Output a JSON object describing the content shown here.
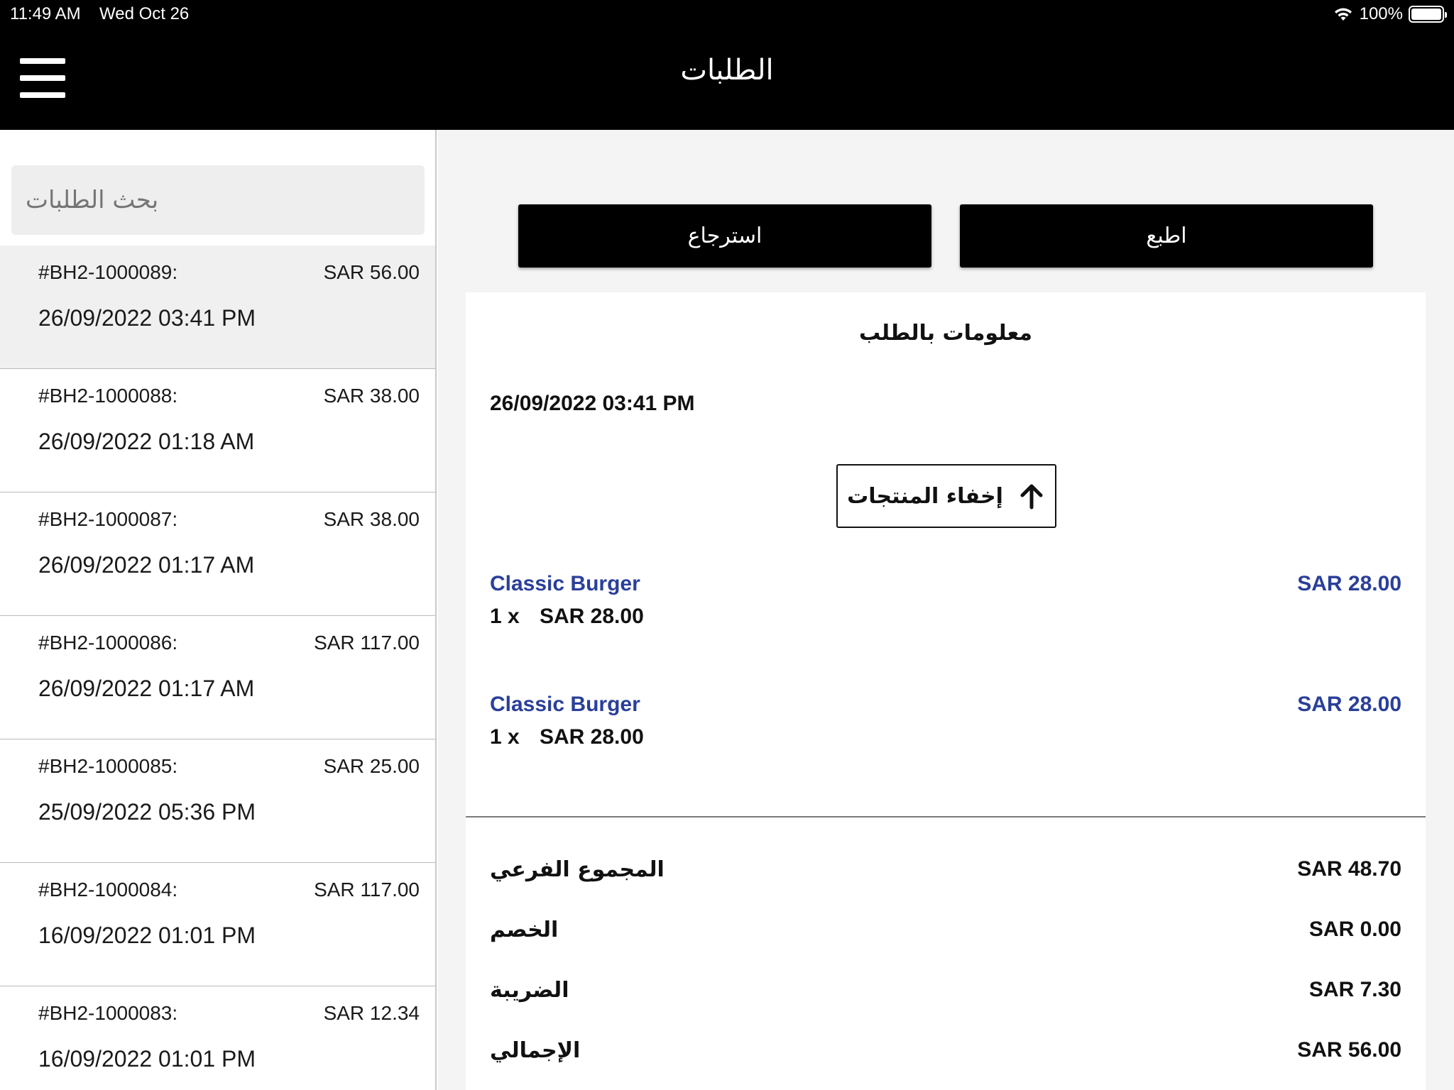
{
  "status_bar": {
    "time": "11:49 AM",
    "date": "Wed Oct 26",
    "battery": "100%",
    "wifi_icon": "wifi-icon",
    "battery_level": 1.0
  },
  "header": {
    "title": "الطلبات",
    "menu_icon": "hamburger-menu-icon"
  },
  "search": {
    "placeholder": "بحث الطلبات"
  },
  "orders": [
    {
      "id": "#BH2-1000089:",
      "price": "SAR 56.00",
      "date": "26/09/2022 03:41 PM",
      "selected": true
    },
    {
      "id": "#BH2-1000088:",
      "price": "SAR 38.00",
      "date": "26/09/2022 01:18 AM"
    },
    {
      "id": "#BH2-1000087:",
      "price": "SAR 38.00",
      "date": "26/09/2022 01:17 AM"
    },
    {
      "id": "#BH2-1000086:",
      "price": "SAR 117.00",
      "date": "26/09/2022 01:17 AM"
    },
    {
      "id": "#BH2-1000085:",
      "price": "SAR 25.00",
      "date": "25/09/2022 05:36 PM"
    },
    {
      "id": "#BH2-1000084:",
      "price": "SAR 117.00",
      "date": "16/09/2022 01:01 PM"
    },
    {
      "id": "#BH2-1000083:",
      "price": "SAR 12.34",
      "date": "16/09/2022 01:01 PM"
    }
  ],
  "actions": {
    "refund_label": "استرجاع",
    "print_label": "اطبع"
  },
  "detail": {
    "title": "معلومات بالطلب",
    "date": "26/09/2022 03:41 PM",
    "hide_products_label": "إخفاء المنتجات",
    "hide_products_icon": "arrow-up-icon",
    "products": [
      {
        "name": "Classic Burger",
        "price": "SAR 28.00",
        "qty": "1 x",
        "unit_price": "SAR 28.00"
      },
      {
        "name": "Classic Burger",
        "price": "SAR 28.00",
        "qty": "1 x",
        "unit_price": "SAR 28.00"
      }
    ],
    "totals": [
      {
        "label": "المجموع الفرعي",
        "value": "SAR 48.70"
      },
      {
        "label": "الخصم",
        "value": "SAR 0.00"
      },
      {
        "label": "الضريبة",
        "value": "SAR 7.30"
      },
      {
        "label": "الإجمالي",
        "value": "SAR 56.00"
      }
    ]
  },
  "colors": {
    "header_bg": "#000000",
    "product_blue": "#2a3f9a",
    "panel_bg": "#f4f4f4"
  }
}
